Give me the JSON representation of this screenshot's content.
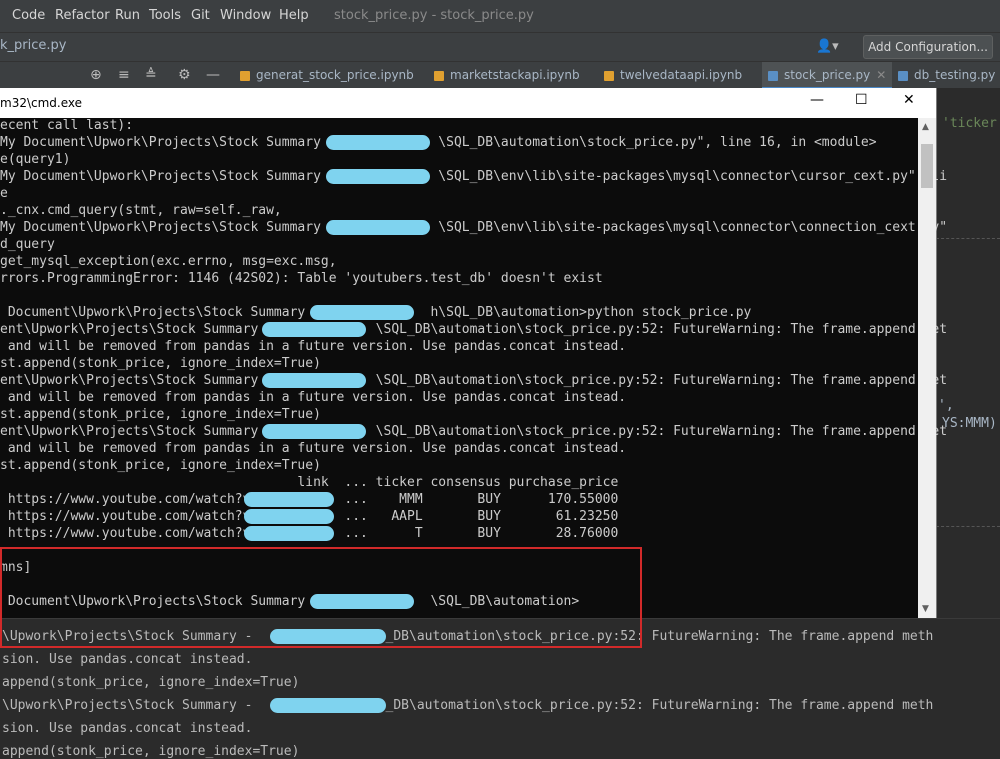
{
  "menu": [
    "Code",
    "Refactor",
    "Run",
    "Tools",
    "Git",
    "Window",
    "Help"
  ],
  "window_title": "stock_price.py - stock_price.py",
  "nav": {
    "current_file": "k_price.py",
    "add_configuration": "Add Configuration..."
  },
  "tabs": [
    {
      "label": "generat_stock_price.ipynb"
    },
    {
      "label": "marketstackapi.ipynb"
    },
    {
      "label": "twelvedataapi.ipynb"
    },
    {
      "label": "stock_price.py"
    },
    {
      "label": "db_testing.py"
    }
  ],
  "cmd": {
    "title": "m32\\cmd.exe",
    "lines": [
      "ecent call last):",
      "My Document\\Upwork\\Projects\\Stock Summary -             \\SQL_DB\\automation\\stock_price.py\", line 16, in <module>",
      "e(query1)",
      "My Document\\Upwork\\Projects\\Stock Summary -             \\SQL_DB\\env\\lib\\site-packages\\mysql\\connector\\cursor_cext.py\", li",
      "e",
      "._cnx.cmd_query(stmt, raw=self._raw,",
      "My Document\\Upwork\\Projects\\Stock Summary -             \\SQL_DB\\env\\lib\\site-packages\\mysql\\connector\\connection_cext.py\"",
      "d_query",
      "get_mysql_exception(exc.errno, msg=exc.msg,",
      "rrors.ProgrammingError: 1146 (42S02): Table 'youtubers.test_db' doesn't exist",
      "",
      " Document\\Upwork\\Projects\\Stock Summary -              h\\SQL_DB\\automation>python stock_price.py",
      "ent\\Upwork\\Projects\\Stock Summary -             \\SQL_DB\\automation\\stock_price.py:52: FutureWarning: The frame.append met",
      " and will be removed from pandas in a future version. Use pandas.concat instead.",
      "st.append(stonk_price, ignore_index=True)",
      "ent\\Upwork\\Projects\\Stock Summary -             \\SQL_DB\\automation\\stock_price.py:52: FutureWarning: The frame.append met",
      " and will be removed from pandas in a future version. Use pandas.concat instead.",
      "st.append(stonk_price, ignore_index=True)",
      "ent\\Upwork\\Projects\\Stock Summary -             \\SQL_DB\\automation\\stock_price.py:52: FutureWarning: The frame.append met",
      " and will be removed from pandas in a future version. Use pandas.concat instead.",
      "st.append(stonk_price, ignore_index=True)",
      "                                      link  ... ticker consensus purchase_price",
      " https://www.youtube.com/watch?v            ...    MMM       BUY      170.55000",
      " https://www.youtube.com/watch?v            ...   AAPL       BUY       61.23250",
      " https://www.youtube.com/watch?v            ...      T       BUY       28.76000",
      "",
      "mns]",
      "",
      " Document\\Upwork\\Projects\\Stock Summary -              \\SQL_DB\\automation>"
    ]
  },
  "editor": {
    "snippet1": "'ticker",
    "snippet2": "YS:MMM)",
    "snippet3": "',"
  },
  "run_output": [
    "\\Upwork\\Projects\\Stock Summary -             \\SQL_DB\\automation\\stock_price.py:52: FutureWarning: The frame.append meth",
    "sion. Use pandas.concat instead.",
    "append(stonk_price, ignore_index=True)",
    "\\Upwork\\Projects\\Stock Summary -             \\SQL_DB\\automation\\stock_price.py:52: FutureWarning: The frame.append meth",
    "sion. Use pandas.concat instead.",
    "append(stonk_price, ignore_index=True)"
  ],
  "colors": {
    "redaction": "#7fd3ef",
    "highlight": "#d22a2a",
    "terminal_bg": "#0c0c0c",
    "ide_bg": "#2b2b2b"
  },
  "icons": [
    "crosshair-icon",
    "collapse-all-icon",
    "expand-all-icon",
    "gear-icon",
    "minimize-icon",
    "user-icon",
    "close-icon",
    "maximize-icon"
  ]
}
